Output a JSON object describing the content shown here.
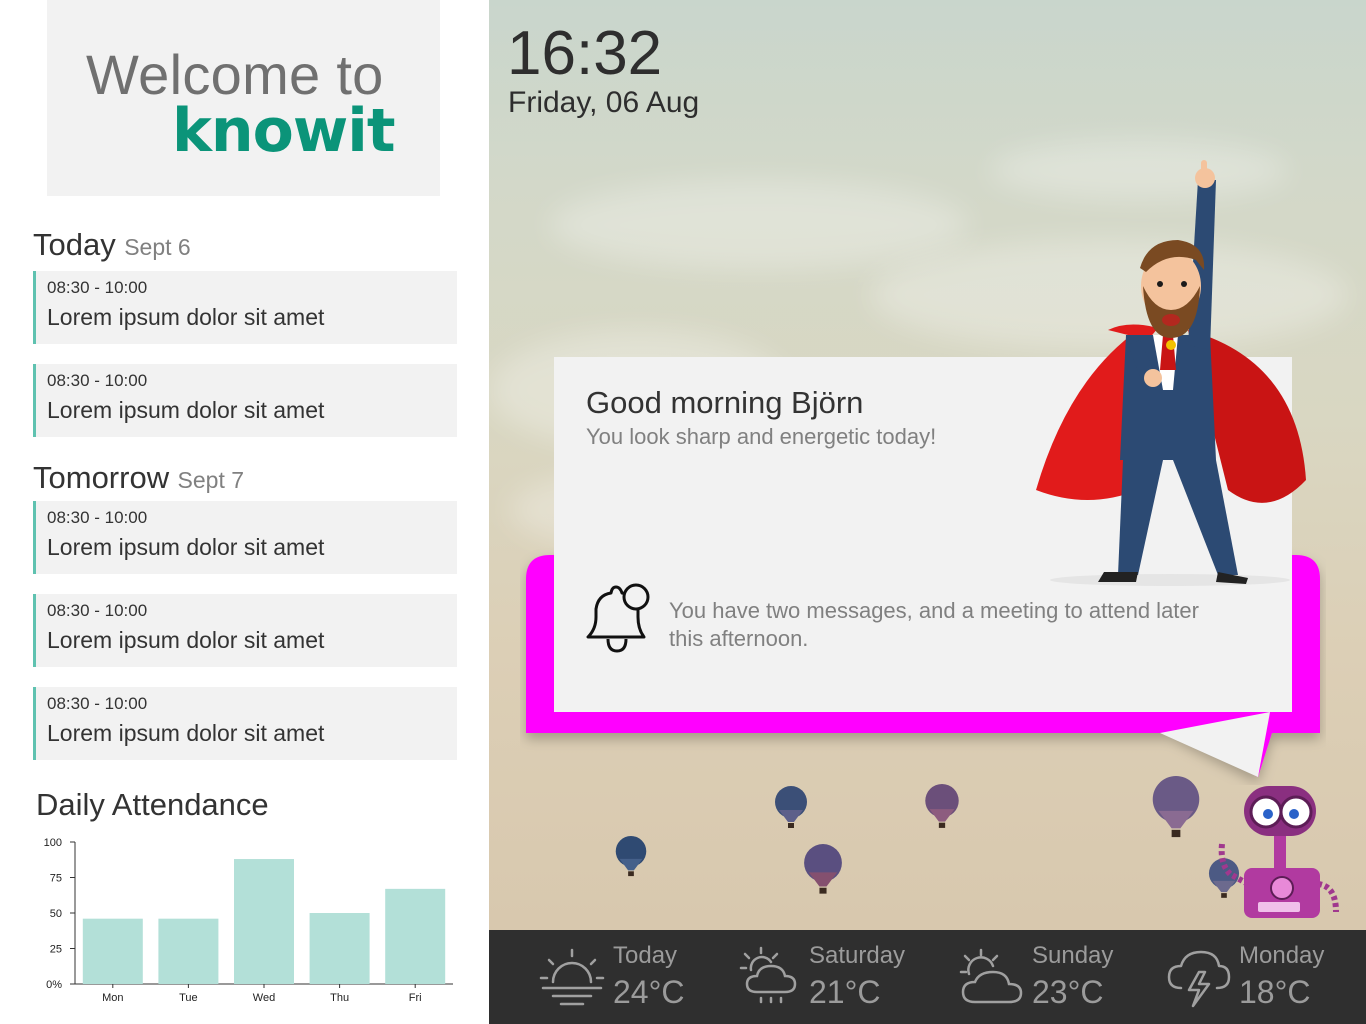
{
  "welcome": {
    "line1": "Welcome to",
    "brand": "knowit"
  },
  "schedule": {
    "today": {
      "label": "Today",
      "date": "Sept 6",
      "events": [
        {
          "time": "08:30 - 10:00",
          "title": "Lorem ipsum dolor sit amet"
        },
        {
          "time": "08:30 - 10:00",
          "title": "Lorem ipsum dolor sit amet"
        }
      ]
    },
    "tomorrow": {
      "label": "Tomorrow",
      "date": "Sept 7",
      "events": [
        {
          "time": "08:30 - 10:00",
          "title": "Lorem ipsum dolor sit amet"
        },
        {
          "time": "08:30 - 10:00",
          "title": "Lorem ipsum dolor sit amet"
        },
        {
          "time": "08:30 - 10:00",
          "title": "Lorem ipsum dolor sit amet"
        }
      ]
    }
  },
  "attendance": {
    "title": "Daily Attendance"
  },
  "chart_data": {
    "type": "bar",
    "title": "Daily Attendance",
    "categories": [
      "Mon",
      "Tue",
      "Wed",
      "Thu",
      "Fri"
    ],
    "values": [
      46,
      46,
      88,
      50,
      67
    ],
    "yticks": [
      "0%",
      "25",
      "50",
      "75",
      "100"
    ],
    "ylim": [
      0,
      100
    ],
    "bar_color": "#b3e0d8",
    "grid": false
  },
  "clock": {
    "time": "16:32",
    "date": "Friday, 06 Aug"
  },
  "greeting": {
    "title": "Good morning Björn",
    "subtitle": "You look sharp and energetic today!",
    "message": "You have two messages, and a meeting to attend later this afternoon.",
    "icon": "bell-notification-icon"
  },
  "weather": [
    {
      "day": "Today",
      "temp": "24°C",
      "icon": "sunrise-icon"
    },
    {
      "day": "Saturday",
      "temp": "21°C",
      "icon": "sun-cloud-rain-icon"
    },
    {
      "day": "Sunday",
      "temp": "23°C",
      "icon": "sun-cloud-icon"
    },
    {
      "day": "Monday",
      "temp": "18°C",
      "icon": "thunderstorm-icon"
    }
  ],
  "colors": {
    "brand": "#0b9479",
    "accent_bar": "#5fc2b0",
    "bubble": "#ff00ff",
    "weather_bar": "#2f2f2f"
  }
}
